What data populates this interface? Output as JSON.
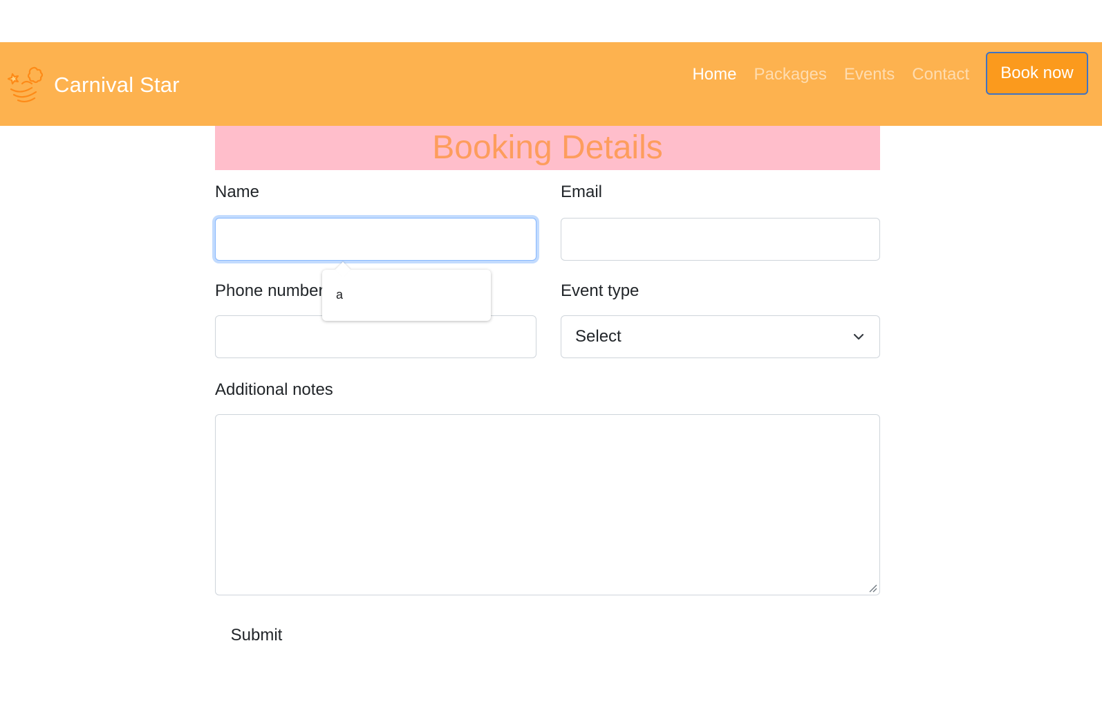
{
  "nav": {
    "brand": "Carnival Star",
    "links": [
      "Home",
      "Packages",
      "Events",
      "Contact"
    ],
    "cta": "Book now"
  },
  "form": {
    "title": "Booking Details",
    "name_label": "Name",
    "email_label": "Email",
    "phone_label": "Phone number",
    "event_label": "Event type",
    "event_selected": "Select",
    "notes_label": "Additional notes",
    "submit_label": "Submit"
  },
  "autofill": {
    "suggestion": "a"
  },
  "colors": {
    "navbar": "#fdb24f",
    "cta_bg": "#fb9a1d",
    "banner_bg": "#ffbecb",
    "title": "#fd9d5d"
  }
}
